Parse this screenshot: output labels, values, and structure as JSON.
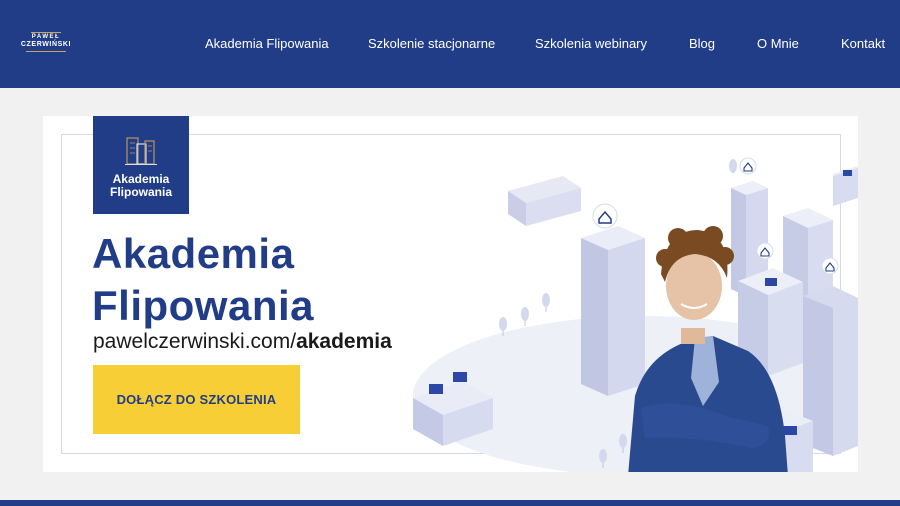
{
  "logo": {
    "line1": "PAWEŁ",
    "line2": "CZERWIŃSKI"
  },
  "nav": {
    "items": [
      {
        "label": "Akademia Flipowania"
      },
      {
        "label": "Szkolenie stacjonarne"
      },
      {
        "label": "Szkolenia webinary"
      },
      {
        "label": "Blog"
      },
      {
        "label": "O Mnie"
      },
      {
        "label": "Kontakt"
      }
    ]
  },
  "banner": {
    "badge_line1": "Akademia",
    "badge_line2": "Flipowania",
    "heading_line1": "Akademia",
    "heading_line2": "Flipowania",
    "url_prefix": "pawelczerwinski.com/",
    "url_suffix": "akademia",
    "cta_label": "DOŁĄCZ DO SZKOLENIA"
  },
  "colors": {
    "brand_blue": "#213d88",
    "cta_yellow": "#f7ce36",
    "background": "#f1f1f1"
  }
}
